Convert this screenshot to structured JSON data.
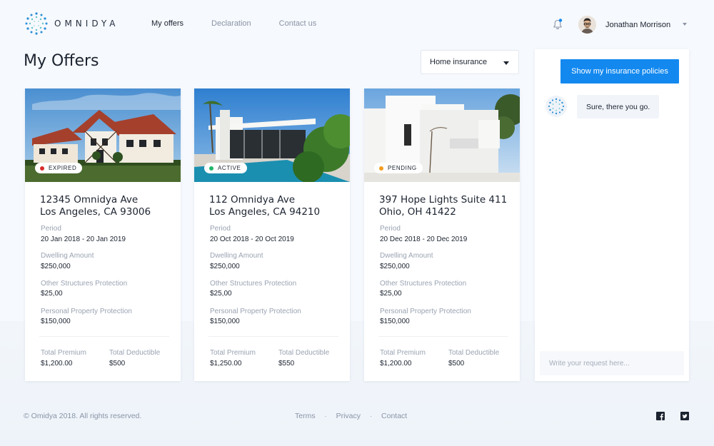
{
  "brand": {
    "name": "OMNIDYA",
    "accent": "#1389f0"
  },
  "nav": {
    "items": [
      {
        "label": "My offers",
        "active": true
      },
      {
        "label": "Declaration",
        "active": false
      },
      {
        "label": "Contact us",
        "active": false
      }
    ]
  },
  "header": {
    "notification_icon": "bell-icon",
    "has_notification": true,
    "user_name": "Jonathan Morrison"
  },
  "page": {
    "title": "My Offers",
    "filter_selected": "Home insurance"
  },
  "offers": [
    {
      "status": "EXPIRED",
      "status_color": "#d92b2b",
      "address_line1": "12345 Omnidya Ave",
      "address_line2": "Los Angeles, CA 93006",
      "period_label": "Period",
      "period": "20 Jan 2018 - 20 Jan 2019",
      "dwelling_label": "Dwelling Amount",
      "dwelling": "$250,000",
      "other_label": "Other Structures Protection",
      "other": "$25,00",
      "personal_label": "Personal Property Protection",
      "personal": "$150,000",
      "premium_label": "Total Premium",
      "premium": "$1,200.00",
      "deductible_label": "Total Deductible",
      "deductible": "$500"
    },
    {
      "status": "ACTIVE",
      "status_color": "#1fb66a",
      "address_line1": "112 Omnidya Ave",
      "address_line2": "Los Angeles, CA 94210",
      "period_label": "Period",
      "period": "20 Oct 2018 - 20 Oct 2019",
      "dwelling_label": "Dwelling Amount",
      "dwelling": "$250,000",
      "other_label": "Other Structures Protection",
      "other": "$25,00",
      "personal_label": "Personal Property Protection",
      "personal": "$150,000",
      "premium_label": "Total Premium",
      "premium": "$1,250.00",
      "deductible_label": "Total Deductible",
      "deductible": "$550"
    },
    {
      "status": "PENDING",
      "status_color": "#f39c1f",
      "address_line1": "397 Hope Lights Suite 411",
      "address_line2": "Ohio, OH 41422",
      "period_label": "Period",
      "period": "20 Dec 2018 - 20 Dec 2019",
      "dwelling_label": "Dwelling Amount",
      "dwelling": "$250,000",
      "other_label": "Other Structures Protection",
      "other": "$25,00",
      "personal_label": "Personal Property Protection",
      "personal": "$150,000",
      "premium_label": "Total Premium",
      "premium": "$1,200.00",
      "deductible_label": "Total Deductible",
      "deductible": "$500"
    }
  ],
  "chat": {
    "user_message": "Show my insurance policies",
    "bot_message": "Sure, there you go.",
    "input_placeholder": "Write your request here..."
  },
  "footer": {
    "copyright": "© Omidya 2018. All rights reserved.",
    "links": [
      "Terms",
      "Privacy",
      "Contact"
    ],
    "separator": "·",
    "social": [
      "facebook-icon",
      "twitter-icon"
    ]
  }
}
